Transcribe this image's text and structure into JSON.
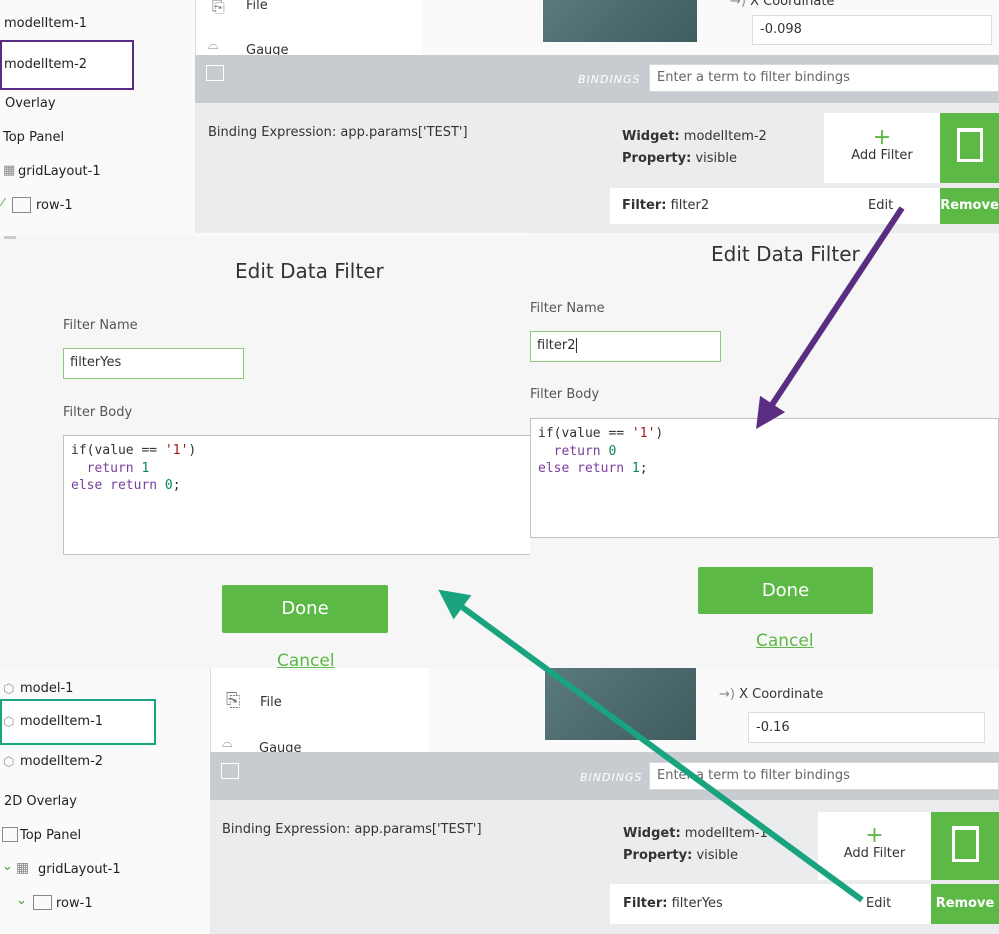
{
  "top": {
    "tree": [
      "modelItem-1",
      "modelItem-2",
      "Overlay",
      "Top Panel",
      "gridLayout-1",
      "row-1"
    ],
    "widgets": [
      "File",
      "Gauge"
    ],
    "coord_label": "X Coordinate",
    "coord_value": "-0.098",
    "bindings_label": "BINDINGS",
    "bindings_placeholder": "Enter a term to filter bindings",
    "binding_expression_label": "Binding Expression:",
    "binding_expression_value": "app.params['TEST']",
    "widget_label": "Widget:",
    "widget_value": "modelItem-2",
    "property_label": "Property:",
    "property_value": "visible",
    "add_filter": "Add Filter",
    "filter_label": "Filter:",
    "filter_value": "filter2",
    "edit": "Edit",
    "remove": "Remove"
  },
  "dialog_left": {
    "title": "Edit Data Filter",
    "name_label": "Filter Name",
    "name_value": "filterYes",
    "body_label": "Filter Body",
    "code": [
      "if(value == '1')",
      "  return 1",
      "else return 0;"
    ],
    "done": "Done",
    "cancel": "Cancel"
  },
  "dialog_right": {
    "title": "Edit Data Filter",
    "name_label": "Filter Name",
    "name_value": "filter2",
    "body_label": "Filter Body",
    "code": [
      "if(value == '1')",
      "  return 0",
      "else return 1;"
    ],
    "done": "Done",
    "cancel": "Cancel"
  },
  "bottom": {
    "tree": [
      "model-1",
      "modelItem-1",
      "modelItem-2",
      "2D Overlay",
      "Top Panel",
      "gridLayout-1",
      "row-1"
    ],
    "widgets": [
      "File",
      "Gauge"
    ],
    "coord_label": "X Coordinate",
    "coord_value": "-0.16",
    "bindings_label": "BINDINGS",
    "bindings_placeholder": "Enter a term to filter bindings",
    "binding_expression_label": "Binding Expression:",
    "binding_expression_value": "app.params['TEST']",
    "widget_label": "Widget:",
    "widget_value": "modelItem-1",
    "property_label": "Property:",
    "property_value": "visible",
    "add_filter": "Add Filter",
    "filter_label": "Filter:",
    "filter_value": "filterYes",
    "edit": "Edit",
    "remove": "Remove"
  },
  "colors": {
    "accent_green": "#5cb946",
    "purple_highlight": "#5b2d82",
    "teal_highlight": "#1aa37f"
  }
}
